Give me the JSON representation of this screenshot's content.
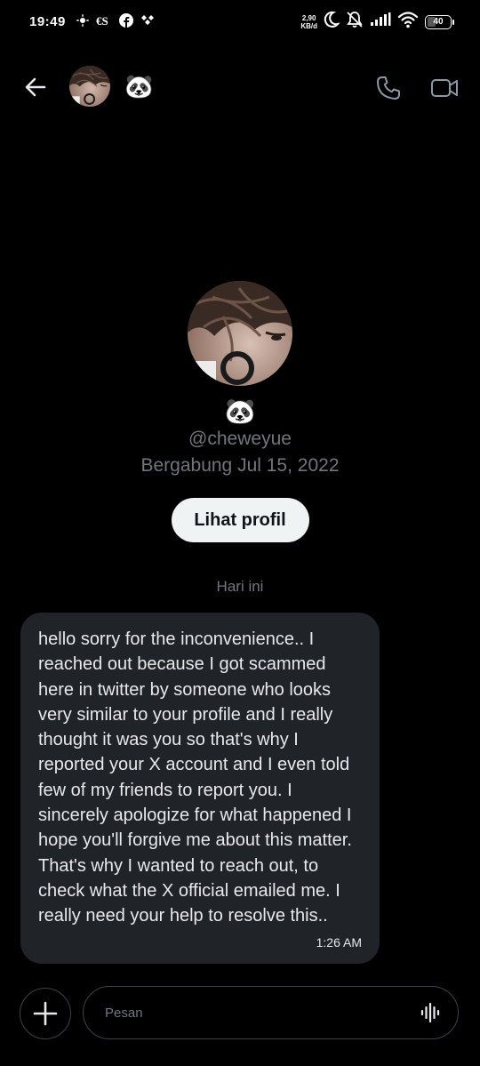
{
  "status_bar": {
    "time": "19:49",
    "net_speed_value": "2,90",
    "net_speed_unit": "KB/d",
    "battery_level": "40",
    "battery_fraction": 0.4,
    "left_icons": [
      "weather-icon",
      "news-app-icon",
      "facebook-icon",
      "app-notification-icon"
    ],
    "right_icons": [
      "moon-icon",
      "bell-muted-icon",
      "signal-icon",
      "wifi-icon",
      "battery-icon"
    ]
  },
  "header": {
    "name": "🐼",
    "back_icon": "arrow-left-icon",
    "call_icon": "phone-icon",
    "video_icon": "video-icon"
  },
  "profile": {
    "name": "🐼",
    "handle": "@cheweyue",
    "joined": "Bergabung Jul 15, 2022",
    "view_profile_label": "Lihat profil"
  },
  "conversation": {
    "date_separator": "Hari ini",
    "messages": [
      {
        "text": "hello sorry for the inconvenience.. I reached out because I got scammed here in twitter by someone who looks very similar to your profile and I really thought it was you so that's why I reported your X account and I even told few of my friends to report you. I sincerely apologize for what happened I hope you'll forgive me about this matter. That's why I wanted to reach out, to check what the X official emailed me. I really need your help to resolve this..",
        "time": "1:26 AM"
      }
    ]
  },
  "composer": {
    "placeholder": "Pesan",
    "attach_icon": "plus-icon",
    "voice_icon": "voice-wave-icon"
  },
  "colors": {
    "background": "#000000",
    "bubble": "#202327",
    "text_primary": "#e7e9ea",
    "text_secondary": "#71767b",
    "button_light": "#eff3f4",
    "border": "#3e4144"
  }
}
